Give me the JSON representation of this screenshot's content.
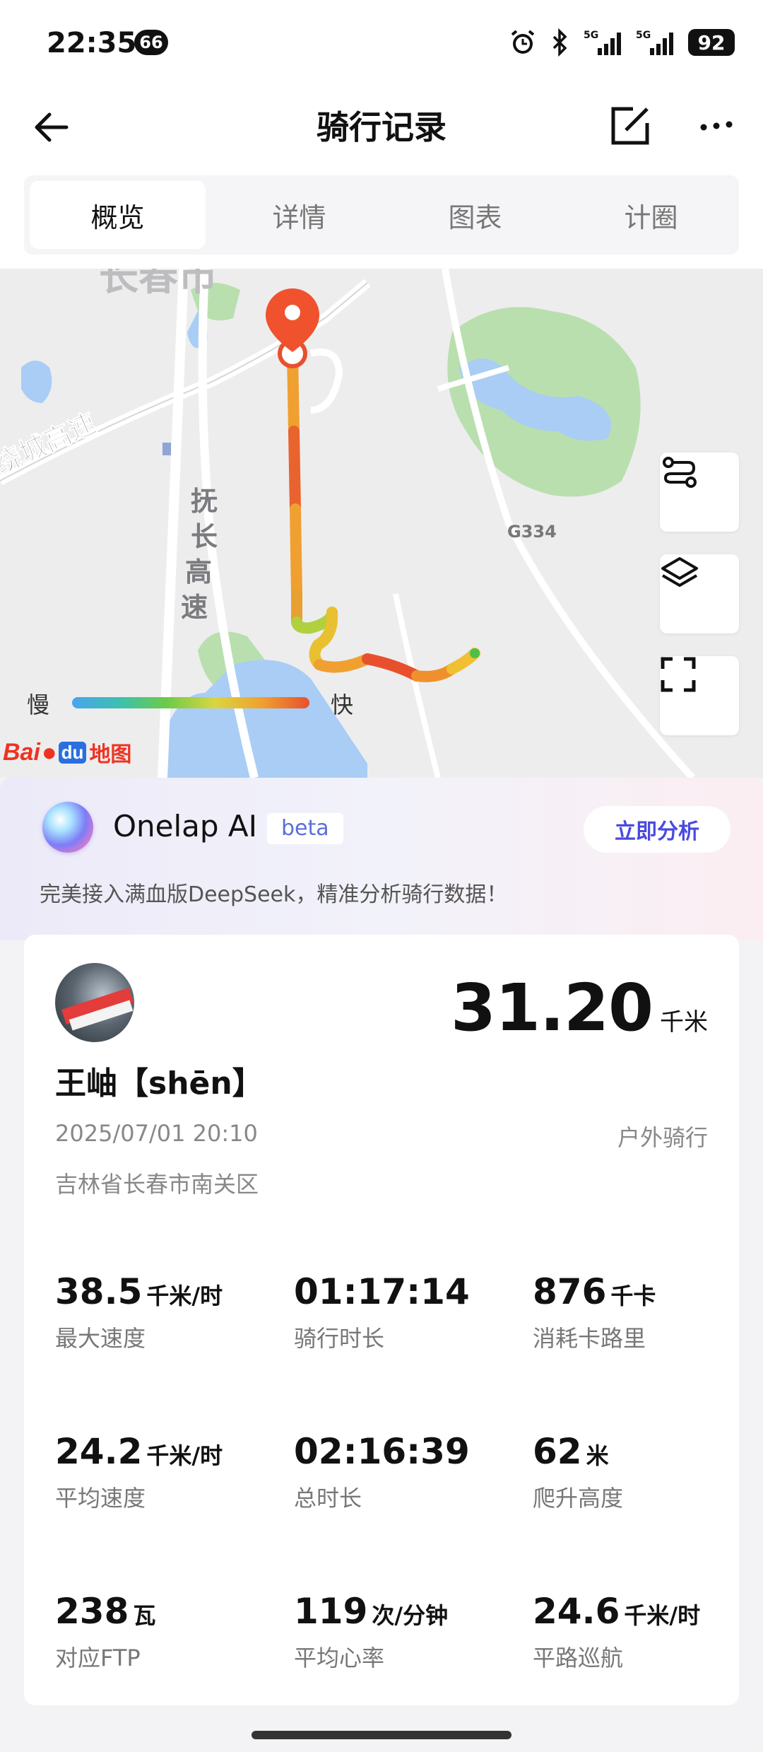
{
  "status_bar": {
    "time": "22:35",
    "notification_count": "66",
    "icons": [
      "alarm-icon",
      "bluetooth-icon",
      "signal-5g-icon",
      "signal-5g-icon"
    ],
    "signal_label_1": "5G",
    "signal_label_2": "5G",
    "battery": "92"
  },
  "header": {
    "title": "骑行记录"
  },
  "tabs": [
    {
      "label": "概览",
      "active": true
    },
    {
      "label": "详情",
      "active": false
    },
    {
      "label": "图表",
      "active": false
    },
    {
      "label": "计圈",
      "active": false
    }
  ],
  "map": {
    "labels": {
      "city": "长春市",
      "expressway_ring": "绕城高速",
      "expressway_fuchang": "抚长高速",
      "road_g334": "G334"
    },
    "legend": {
      "slow": "慢",
      "fast": "快"
    },
    "provider": {
      "bai": "Bai",
      "du": "du",
      "ditu": "地图"
    }
  },
  "ai": {
    "name": "Onelap AI",
    "badge": "beta",
    "button": "立即分析",
    "description": "完美接入满血版DeepSeek，精准分析骑行数据！"
  },
  "summary": {
    "distance_value": "31.20",
    "distance_unit": "千米",
    "username": "王岫【shēn】",
    "datetime": "2025/07/01 20:10",
    "ride_type": "户外骑行",
    "location": "吉林省长春市南关区"
  },
  "stats": [
    {
      "value": "38.5",
      "unit": "千米/时",
      "label": "最大速度"
    },
    {
      "value": "01:17:14",
      "unit": "",
      "label": "骑行时长"
    },
    {
      "value": "876",
      "unit": "千卡",
      "label": "消耗卡路里"
    },
    {
      "value": "24.2",
      "unit": "千米/时",
      "label": "平均速度"
    },
    {
      "value": "02:16:39",
      "unit": "",
      "label": "总时长"
    },
    {
      "value": "62",
      "unit": "米",
      "label": "爬升高度"
    },
    {
      "value": "238",
      "unit": "瓦",
      "label": "对应FTP"
    },
    {
      "value": "119",
      "unit": "次/分钟",
      "label": "平均心率"
    },
    {
      "value": "24.6",
      "unit": "千米/时",
      "label": "平路巡航"
    }
  ],
  "colors": {
    "route_fast": "#e8502d",
    "route_mid": "#f0a030",
    "route_slow": "#6ccb48",
    "ai_accent": "#4a4adf"
  }
}
